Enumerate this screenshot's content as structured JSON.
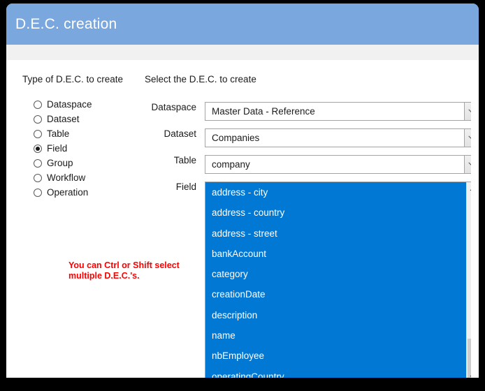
{
  "window": {
    "header_bg": "#7aa7de",
    "accent": "#0078d4",
    "hint_color": "#ff0000",
    "title": "D.E.C. creation"
  },
  "left_panel": {
    "heading": "Type of D.E.C. to create",
    "radios": [
      {
        "label": "Dataspace",
        "checked": false
      },
      {
        "label": "Dataset",
        "checked": false
      },
      {
        "label": "Table",
        "checked": false
      },
      {
        "label": "Field",
        "checked": true
      },
      {
        "label": "Group",
        "checked": false
      },
      {
        "label": "Workflow",
        "checked": false
      },
      {
        "label": "Operation",
        "checked": false
      }
    ],
    "hint": "You can Ctrl or Shift select multiple D.E.C.'s."
  },
  "right_panel": {
    "heading": "Select the D.E.C. to create",
    "selects": [
      {
        "label": "Dataspace",
        "value": "Master Data - Reference"
      },
      {
        "label": "Dataset",
        "value": "Companies"
      },
      {
        "label": "Table",
        "value": "company"
      }
    ],
    "listbox": {
      "label": "Field",
      "items": [
        {
          "label": "address - city",
          "selected": true
        },
        {
          "label": "address - country",
          "selected": true
        },
        {
          "label": "address - street",
          "selected": true
        },
        {
          "label": "bankAccount",
          "selected": true
        },
        {
          "label": "category",
          "selected": true
        },
        {
          "label": "creationDate",
          "selected": true
        },
        {
          "label": "description",
          "selected": true
        },
        {
          "label": "name",
          "selected": true
        },
        {
          "label": "nbEmployee",
          "selected": true
        },
        {
          "label": "operatingCountry",
          "selected": true
        }
      ]
    }
  }
}
